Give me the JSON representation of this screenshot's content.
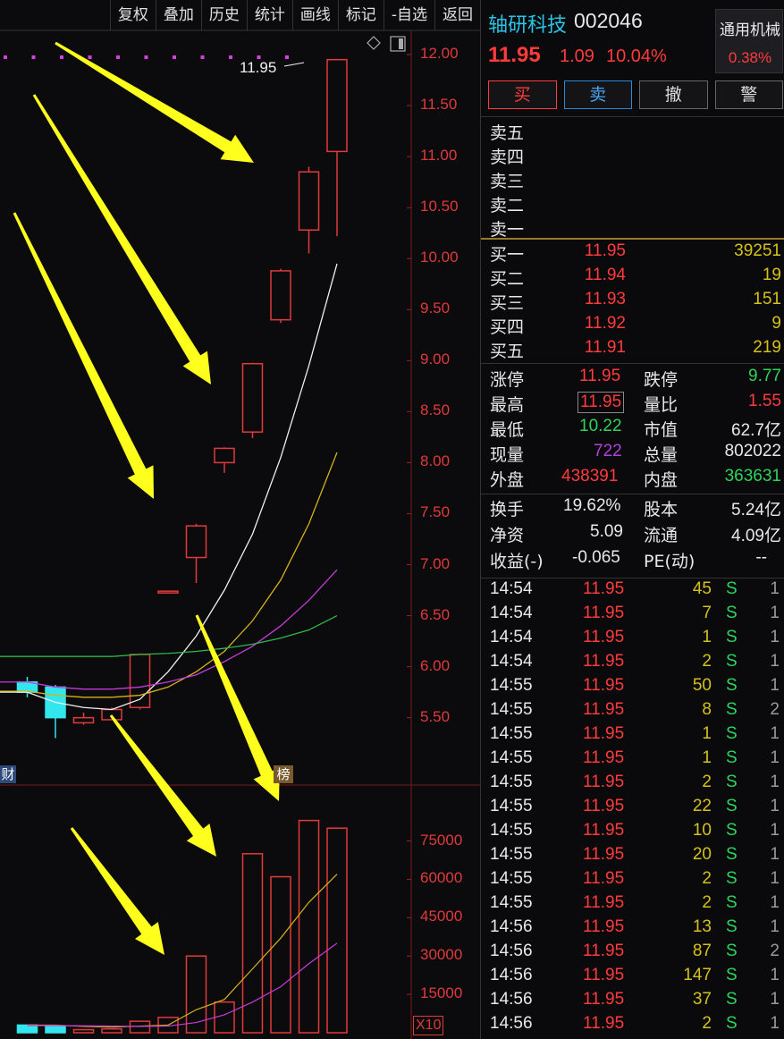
{
  "toolbar": {
    "items": [
      "复权",
      "叠加",
      "历史",
      "统计",
      "画线",
      "标记",
      "-自选",
      "返回"
    ]
  },
  "chart": {
    "price_ticks": [
      "12.00",
      "11.50",
      "11.00",
      "10.50",
      "10.00",
      "9.50",
      "9.00",
      "8.50",
      "8.00",
      "7.50",
      "7.00",
      "6.50",
      "6.00",
      "5.50"
    ],
    "volume_ticks": [
      "75000",
      "60000",
      "45000",
      "30000",
      "15000"
    ],
    "last_price_label": "11.95",
    "event_tag_cai": "财",
    "event_tag_bang": "榜",
    "volume_multiplier": "X10",
    "colors": {
      "up": "#e03a3a",
      "down": "#32e6ee",
      "ma5": "#f0f0f0",
      "ma10": "#d4b21a",
      "ma20": "#c63ad8",
      "ma60": "#2fb84a",
      "arrow": "#ffff1e"
    }
  },
  "chart_data": {
    "type": "candlestick",
    "ylim": [
      5.2,
      12.1
    ],
    "candles": [
      {
        "open": 5.85,
        "close": 5.75,
        "high": 5.9,
        "low": 5.7
      },
      {
        "open": 5.8,
        "close": 5.5,
        "high": 5.82,
        "low": 5.3
      },
      {
        "open": 5.45,
        "close": 5.5,
        "high": 5.55,
        "low": 5.43
      },
      {
        "open": 5.48,
        "close": 5.58,
        "high": 5.6,
        "low": 5.48
      },
      {
        "open": 5.6,
        "close": 6.12,
        "high": 6.13,
        "low": 5.58
      },
      {
        "open": 6.74,
        "close": 6.74,
        "high": 6.74,
        "low": 6.74
      },
      {
        "open": 7.07,
        "close": 7.38,
        "high": 7.4,
        "low": 6.82
      },
      {
        "open": 8.0,
        "close": 8.14,
        "high": 8.15,
        "low": 7.9
      },
      {
        "open": 8.3,
        "close": 8.97,
        "high": 8.98,
        "low": 8.24
      },
      {
        "open": 9.4,
        "close": 9.88,
        "high": 9.9,
        "low": 9.37
      },
      {
        "open": 10.28,
        "close": 10.85,
        "high": 10.9,
        "low": 10.05
      },
      {
        "open": 11.05,
        "close": 11.95,
        "high": 11.95,
        "low": 10.22
      }
    ],
    "ma_series": [
      {
        "values": [
          5.75,
          5.65,
          5.6,
          5.58,
          5.68,
          5.95,
          6.3,
          6.75,
          7.3,
          8.05,
          8.95,
          9.95
        ]
      },
      {
        "values": [
          5.76,
          5.72,
          5.7,
          5.7,
          5.72,
          5.8,
          5.95,
          6.15,
          6.45,
          6.85,
          7.4,
          8.1
        ]
      },
      {
        "values": [
          5.85,
          5.8,
          5.78,
          5.78,
          5.8,
          5.85,
          5.92,
          6.05,
          6.2,
          6.4,
          6.65,
          6.95
        ]
      },
      {
        "values": [
          6.1,
          6.1,
          6.1,
          6.1,
          6.12,
          6.13,
          6.15,
          6.18,
          6.22,
          6.28,
          6.36,
          6.5
        ]
      }
    ],
    "volume": {
      "ylim": [
        0,
        90000
      ],
      "values": [
        3000,
        2500,
        1200,
        1500,
        4500,
        6000,
        30000,
        12000,
        70000,
        61000,
        83000,
        80000
      ],
      "directions": [
        "down",
        "down",
        "up",
        "up",
        "up",
        "up",
        "up",
        "up",
        "up",
        "up",
        "up",
        "up"
      ],
      "ma_series": [
        {
          "values": [
            3000,
            3000,
            2500,
            2200,
            2600,
            3000,
            9000,
            13000,
            25000,
            37000,
            51000,
            62000
          ]
        },
        {
          "values": [
            2800,
            2800,
            2700,
            2600,
            2500,
            2600,
            4000,
            7000,
            12000,
            18000,
            27000,
            35000
          ]
        }
      ]
    }
  },
  "quote": {
    "name": "轴研科技",
    "code": "002046",
    "price": "11.95",
    "change": "1.09",
    "change_pct": "10.04%",
    "sector": "通用机械",
    "sector_pct": "0.38%",
    "actions": {
      "buy": "买",
      "sell": "卖",
      "cancel": "撤",
      "alert": "警"
    },
    "asks": [
      {
        "label": "卖五",
        "price": "",
        "qty": ""
      },
      {
        "label": "卖四",
        "price": "",
        "qty": ""
      },
      {
        "label": "卖三",
        "price": "",
        "qty": ""
      },
      {
        "label": "卖二",
        "price": "",
        "qty": ""
      },
      {
        "label": "卖一",
        "price": "",
        "qty": ""
      }
    ],
    "bids": [
      {
        "label": "买一",
        "price": "11.95",
        "qty": "39251"
      },
      {
        "label": "买二",
        "price": "11.94",
        "qty": "19"
      },
      {
        "label": "买三",
        "price": "11.93",
        "qty": "151"
      },
      {
        "label": "买四",
        "price": "11.92",
        "qty": "9"
      },
      {
        "label": "买五",
        "price": "11.91",
        "qty": "219"
      }
    ],
    "stats": {
      "limit_up_label": "涨停",
      "limit_up": "11.95",
      "limit_down_label": "跌停",
      "limit_down": "9.77",
      "high_label": "最高",
      "high": "11.95",
      "vol_ratio_label": "量比",
      "vol_ratio": "1.55",
      "low_label": "最低",
      "low": "10.22",
      "mkt_cap_label": "市值",
      "mkt_cap": "62.7亿",
      "cur_vol_label": "现量",
      "cur_vol": "722",
      "total_vol_label": "总量",
      "total_vol": "802022",
      "outer_label": "外盘",
      "outer": "438391",
      "inner_label": "内盘",
      "inner": "363631",
      "turnover_label": "换手",
      "turnover": "19.62%",
      "shares_label": "股本",
      "shares": "5.24亿",
      "net_asset_label": "净资",
      "net_asset": "5.09",
      "float_label": "流通",
      "float": "4.09亿",
      "eps_label": "收益(-)",
      "eps": "-0.065",
      "pe_label": "PE(动)",
      "pe": "--"
    },
    "ticks": [
      {
        "time": "14:54",
        "price": "11.95",
        "vol": "45",
        "side": "S",
        "count": "1"
      },
      {
        "time": "14:54",
        "price": "11.95",
        "vol": "7",
        "side": "S",
        "count": "1"
      },
      {
        "time": "14:54",
        "price": "11.95",
        "vol": "1",
        "side": "S",
        "count": "1"
      },
      {
        "time": "14:54",
        "price": "11.95",
        "vol": "2",
        "side": "S",
        "count": "1"
      },
      {
        "time": "14:55",
        "price": "11.95",
        "vol": "50",
        "side": "S",
        "count": "1"
      },
      {
        "time": "14:55",
        "price": "11.95",
        "vol": "8",
        "side": "S",
        "count": "2"
      },
      {
        "time": "14:55",
        "price": "11.95",
        "vol": "1",
        "side": "S",
        "count": "1"
      },
      {
        "time": "14:55",
        "price": "11.95",
        "vol": "1",
        "side": "S",
        "count": "1"
      },
      {
        "time": "14:55",
        "price": "11.95",
        "vol": "2",
        "side": "S",
        "count": "1"
      },
      {
        "time": "14:55",
        "price": "11.95",
        "vol": "22",
        "side": "S",
        "count": "1"
      },
      {
        "time": "14:55",
        "price": "11.95",
        "vol": "10",
        "side": "S",
        "count": "1"
      },
      {
        "time": "14:55",
        "price": "11.95",
        "vol": "20",
        "side": "S",
        "count": "1"
      },
      {
        "time": "14:55",
        "price": "11.95",
        "vol": "2",
        "side": "S",
        "count": "1"
      },
      {
        "time": "14:55",
        "price": "11.95",
        "vol": "2",
        "side": "S",
        "count": "1"
      },
      {
        "time": "14:56",
        "price": "11.95",
        "vol": "13",
        "side": "S",
        "count": "1"
      },
      {
        "time": "14:56",
        "price": "11.95",
        "vol": "87",
        "side": "S",
        "count": "2"
      },
      {
        "time": "14:56",
        "price": "11.95",
        "vol": "147",
        "side": "S",
        "count": "1"
      },
      {
        "time": "14:56",
        "price": "11.95",
        "vol": "37",
        "side": "S",
        "count": "1"
      },
      {
        "time": "14:56",
        "price": "11.95",
        "vol": "2",
        "side": "S",
        "count": "1"
      }
    ]
  }
}
